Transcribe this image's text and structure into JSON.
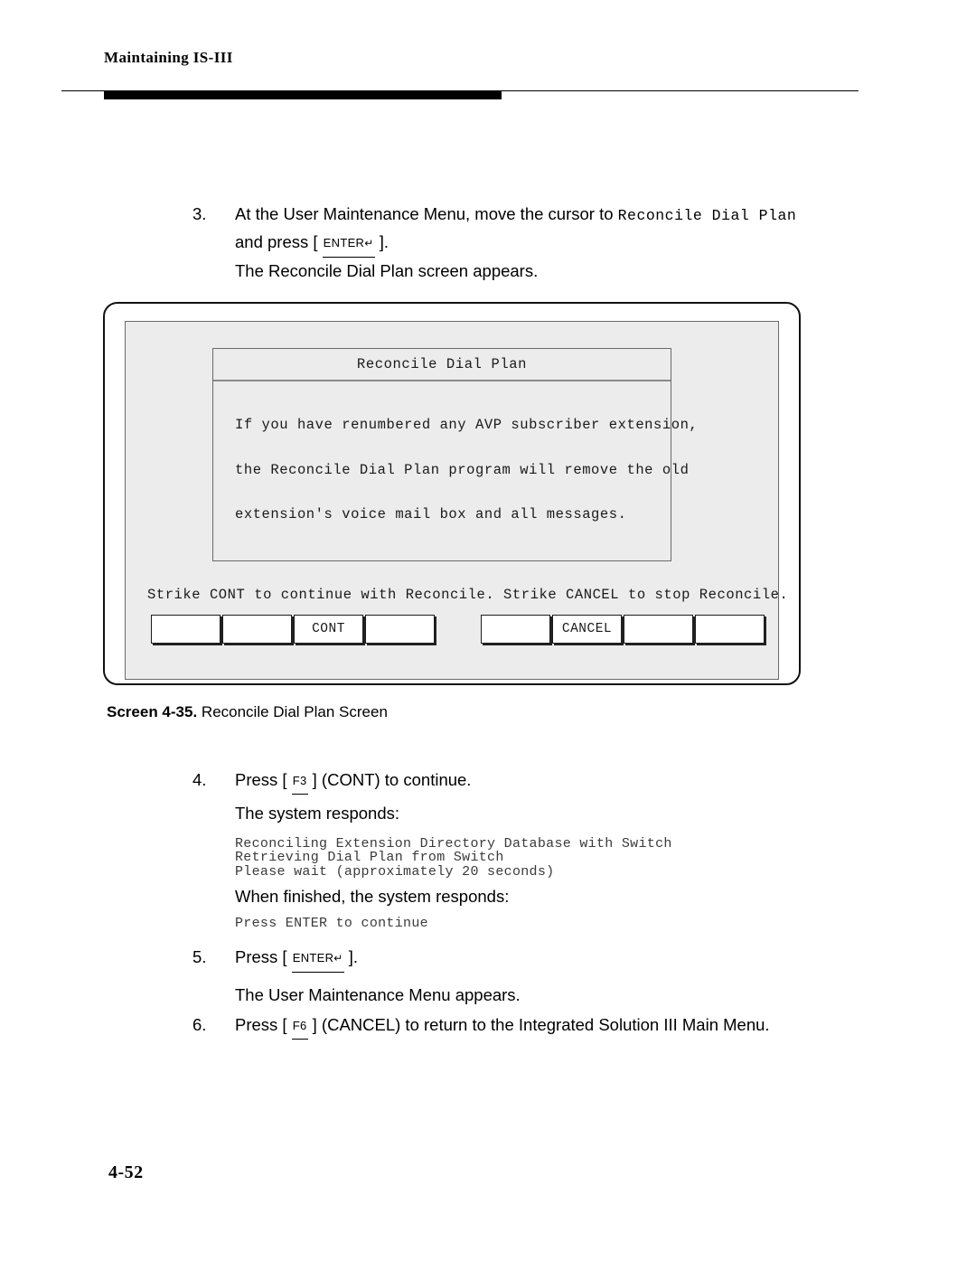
{
  "header": {
    "running_title": "Maintaining IS-III"
  },
  "steps": [
    {
      "number": "3.",
      "text_before": "At the User Maintenance Menu, move the cursor to ",
      "mono_term": "Reconcile Dial Plan",
      "text_after_line2_before_key": "and press [ ",
      "key_label": "ENTER",
      "key_return_glyph": "↵",
      "text_after_line2_after_key": " ].",
      "followup": "The Reconcile Dial Plan screen appears."
    },
    {
      "number": "4.",
      "text_before": "Press [ ",
      "key_label": "F3",
      "text_after": " ] (CONT) to continue.",
      "followup": "The system responds:"
    },
    {
      "number": "5.",
      "text_before": "Press [ ",
      "key_label": "ENTER",
      "key_return_glyph": "↵",
      "text_after": " ].",
      "followup": "The User Maintenance Menu appears."
    },
    {
      "number": "6.",
      "text_before": "Press [ ",
      "key_label": "F6",
      "text_after": " ] (CANCEL) to return to the Integrated Solution III Main Menu."
    }
  ],
  "system_response": {
    "line1": "Reconciling Extension Directory Database with Switch",
    "line2": "Retrieving Dial Plan from Switch",
    "line3": "Please wait (approximately 20 seconds)",
    "when_finished_label": "When finished, the system responds:",
    "finished_line": "Press ENTER to continue"
  },
  "screen": {
    "dialog": {
      "title": "Reconcile Dial Plan",
      "body_line1": "If you have renumbered any AVP subscriber extension,",
      "body_line2": "the Reconcile Dial Plan program will remove the old",
      "body_line3": "extension's voice mail box and all messages."
    },
    "prompt": "Strike CONT to continue with Reconcile. Strike CANCEL to stop Reconcile.",
    "function_keys_left": [
      "",
      "",
      "CONT",
      ""
    ],
    "function_keys_right": [
      "",
      "CANCEL",
      "",
      ""
    ]
  },
  "figure": {
    "caption_label": "Screen 4-35.",
    "caption_text": " Reconcile Dial Plan Screen"
  },
  "folio": {
    "page_number": "4-52"
  },
  "colors": {
    "screen_background": "#ececec",
    "frame_border": "#111111",
    "rule": "#000000"
  }
}
